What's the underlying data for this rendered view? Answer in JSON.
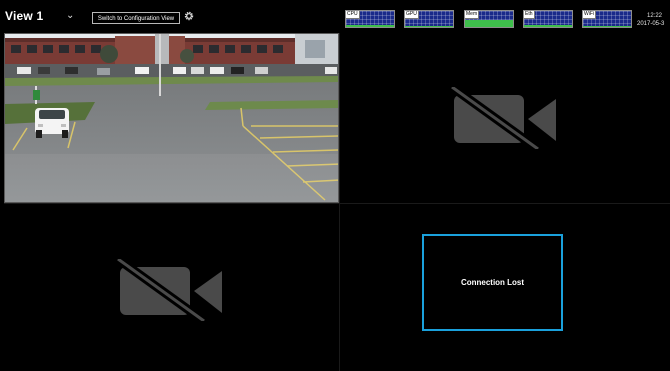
{
  "toolbar": {
    "view_name": "View 1",
    "switch_label": "Switch to Configuration View"
  },
  "meters": [
    {
      "label": "CPU",
      "level": 0.1
    },
    {
      "label": "GPU",
      "level": 0.08
    },
    {
      "label": "Mem",
      "level": 0.45
    },
    {
      "label": "Eth",
      "level": 0.12
    },
    {
      "label": "WiFi",
      "level": 0.08
    }
  ],
  "clock": {
    "time": "12:22",
    "date": "2017-05-3"
  },
  "cells": [
    {
      "state": "live"
    },
    {
      "state": "no-camera"
    },
    {
      "state": "no-camera"
    },
    {
      "state": "connection-lost",
      "message": "Connection Lost"
    }
  ],
  "colors": {
    "meter_bg": "#1a2a8a",
    "meter_fill": "#3fbf4c",
    "lost_border": "#1aa1dc"
  }
}
